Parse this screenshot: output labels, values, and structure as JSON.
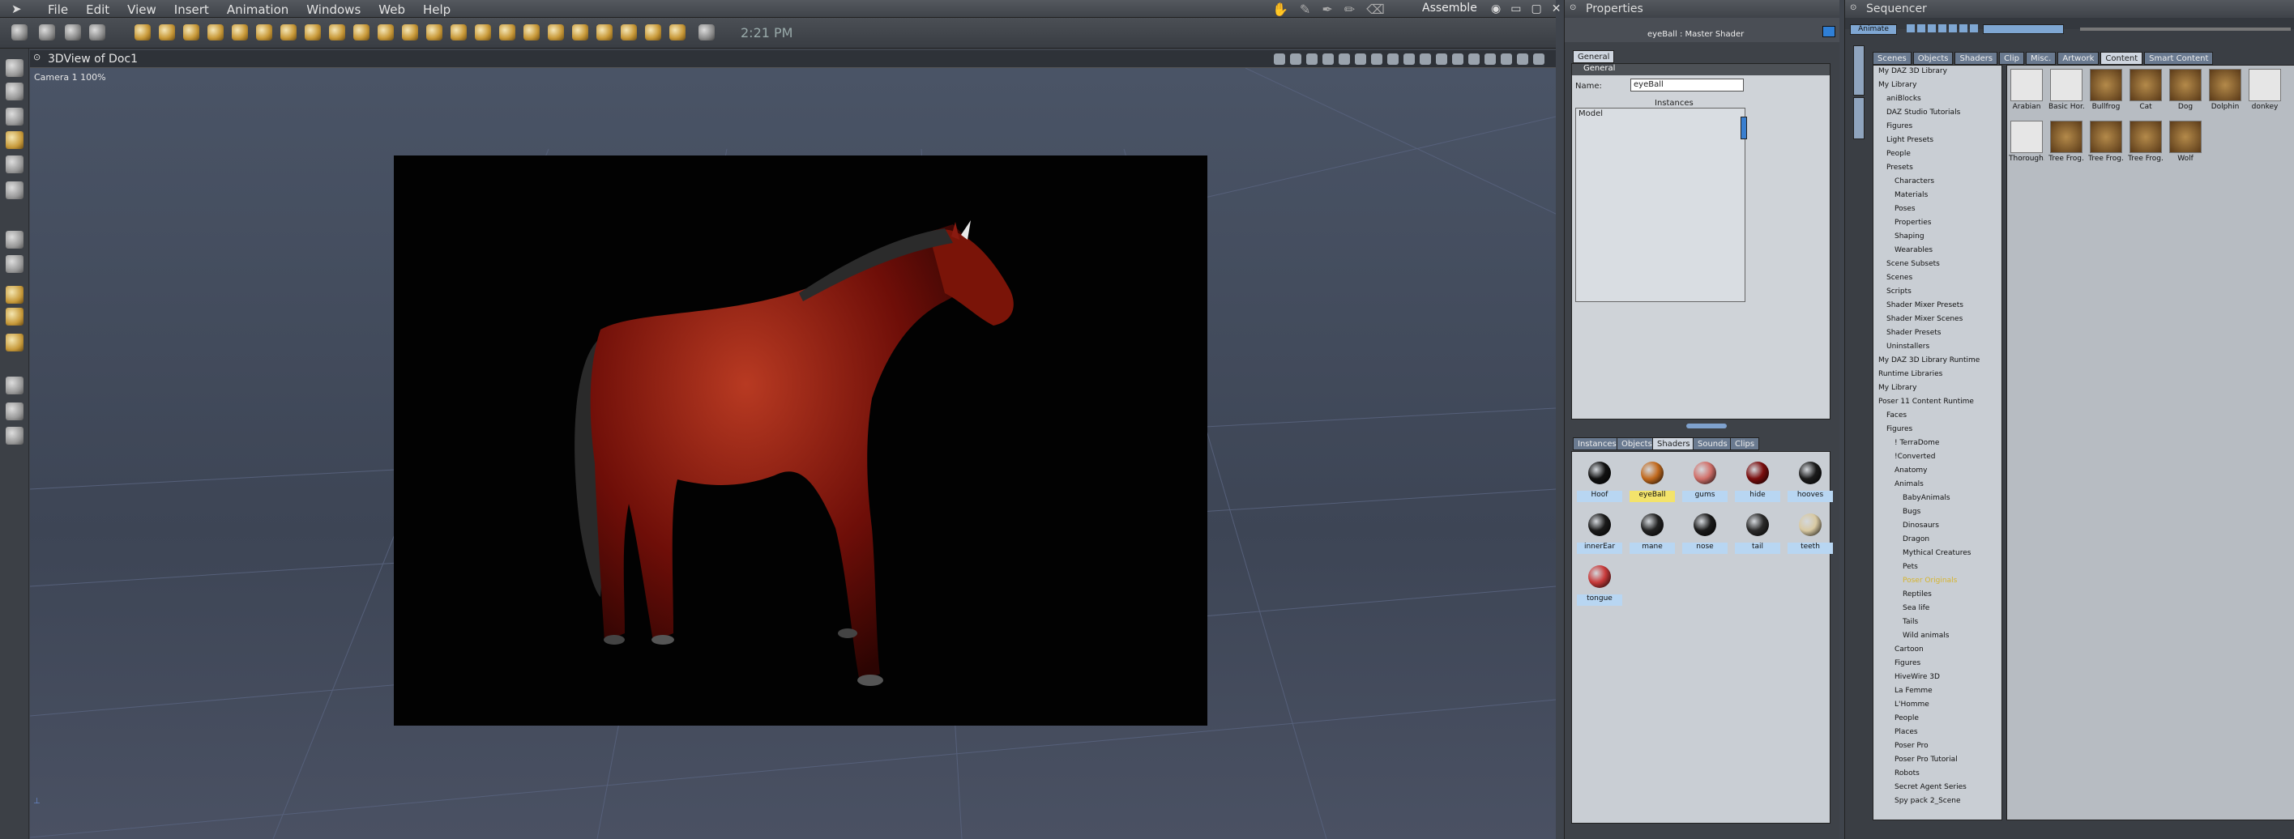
{
  "menubar": {
    "items": [
      "File",
      "Edit",
      "View",
      "Insert",
      "Animation",
      "Windows",
      "Web",
      "Help"
    ],
    "room": "Assemble"
  },
  "toolbar": {
    "clock": "2:21 PM"
  },
  "viewport": {
    "title": "3DView of Doc1",
    "camera": "Camera 1 100%"
  },
  "properties": {
    "title": "Properties",
    "shader_info": "eyeBall : Master Shader",
    "tab_general": "General",
    "section": "General",
    "name_label": "Name:",
    "name_value": "eyeBall",
    "instances_label": "Instances",
    "instances": [
      "Model"
    ],
    "lower_tabs": [
      "Instances",
      "Objects",
      "Shaders",
      "Sounds",
      "Clips"
    ],
    "shaders": [
      {
        "name": "Hoof",
        "color": "#111111"
      },
      {
        "name": "eyeBall",
        "color": "#c26a1e",
        "selected": true
      },
      {
        "name": "gums",
        "color": "#d1706a"
      },
      {
        "name": "hide",
        "color": "#7a0d0d"
      },
      {
        "name": "hooves",
        "color": "#1b1b1b"
      },
      {
        "name": "innerEar",
        "color": "#1a1a1a"
      },
      {
        "name": "mane",
        "color": "#222222"
      },
      {
        "name": "nose",
        "color": "#1a1a1a"
      },
      {
        "name": "tail",
        "color": "#2a2a2a"
      },
      {
        "name": "teeth",
        "color": "#d8c9a2"
      },
      {
        "name": "tongue",
        "color": "#c83a3a"
      }
    ]
  },
  "sequencer": {
    "title": "Sequencer",
    "animate_btn": "Animate",
    "tabs": [
      "Scenes",
      "Objects",
      "Shaders",
      "Clip",
      "Misc.",
      "Artwork",
      "Content",
      "Smart Content"
    ],
    "tree": [
      "My DAZ 3D Library",
      "My Library",
      "aniBlocks",
      "DAZ Studio Tutorials",
      "Figures",
      "Light Presets",
      "People",
      "Presets",
      "Characters",
      "Materials",
      "Poses",
      "Properties",
      "Shaping",
      "Wearables",
      "Scene Subsets",
      "Scenes",
      "Scripts",
      "Shader Mixer Presets",
      "Shader Mixer Scenes",
      "Shader Presets",
      "Uninstallers",
      "My DAZ 3D Library Runtime",
      "Runtime Libraries",
      "My Library",
      "Poser 11 Content Runtime",
      "Faces",
      "Figures",
      "! TerraDome",
      "!Converted",
      "Anatomy",
      "Animals",
      "BabyAnimals",
      "Bugs",
      "Dinosaurs",
      "Dragon",
      "Mythical Creatures",
      "Pets",
      "Poser Originals",
      "Reptiles",
      "Sea life",
      "Tails",
      "Wild animals",
      "Cartoon",
      "Figures",
      "HiveWire 3D",
      "La Femme",
      "L'Homme",
      "People",
      "Places",
      "Poser Pro",
      "Poser Pro Tutorial",
      "Robots",
      "Secret Agent Series",
      "Spy pack 2_Scene"
    ],
    "thumbs": [
      "Arabian",
      "Basic Hor.",
      "Bullfrog",
      "Cat",
      "Dog",
      "Dolphin",
      "donkey",
      "Thorough.",
      "Tree Frog.",
      "Tree Frog.",
      "Tree Frog.",
      "Wolf"
    ]
  }
}
